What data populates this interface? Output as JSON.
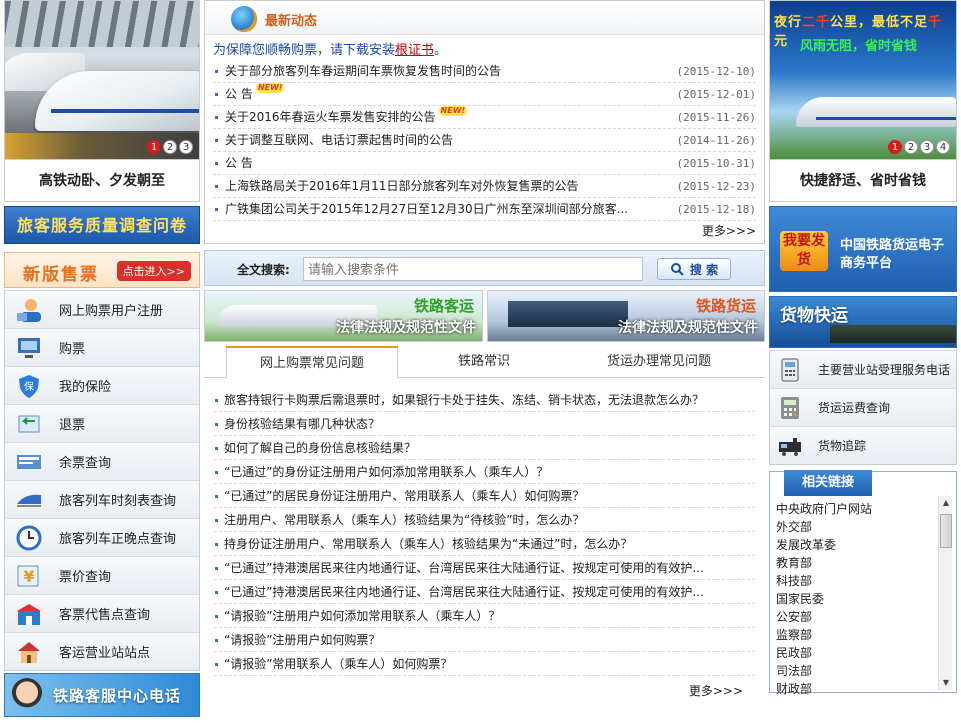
{
  "left": {
    "caption": "高铁动卧、夕发朝至",
    "dots": [
      "1",
      "2",
      "3"
    ],
    "survey": "旅客服务质量调查问卷",
    "newticket": {
      "title": "新版售票",
      "button": "点击进入>>"
    },
    "menu": [
      {
        "label": "网上购票用户注册",
        "icon": "user-register-icon"
      },
      {
        "label": "购票",
        "icon": "ticket-computer-icon"
      },
      {
        "label": "我的保险",
        "icon": "insurance-shield-icon"
      },
      {
        "label": "退票",
        "icon": "refund-arrow-icon"
      },
      {
        "label": "余票查询",
        "icon": "remaining-tickets-icon"
      },
      {
        "label": "旅客列车时刻表查询",
        "icon": "train-schedule-icon"
      },
      {
        "label": "旅客列车正晚点查询",
        "icon": "clock-icon"
      },
      {
        "label": "票价查询",
        "icon": "price-yuan-icon"
      },
      {
        "label": "客票代售点查询",
        "icon": "ticket-agency-icon"
      },
      {
        "label": "客运营业站站点",
        "icon": "station-house-icon"
      }
    ],
    "service": "铁路客服中心电话"
  },
  "news": {
    "title": "最新动态",
    "notice_prefix": "为保障您顺畅购票，请下载安装",
    "notice_link": "根证书",
    "notice_suffix": "。",
    "items": [
      {
        "text": "关于部分旅客列车春运期间车票恢复发售时间的公告",
        "date": "(2015-12-10)",
        "new": false
      },
      {
        "text": "公 告",
        "date": "(2015-12-01)",
        "new": true
      },
      {
        "text": "关于2016年春运火车票发售安排的公告",
        "date": "(2015-11-26)",
        "new": true
      },
      {
        "text": "关于调整互联网、电话订票起售时间的公告",
        "date": "(2014-11-26)",
        "new": false
      },
      {
        "text": "公 告",
        "date": "(2015-10-31)",
        "new": false
      },
      {
        "text": "上海铁路局关于2016年1月11日部分旅客列车对外恢复售票的公告",
        "date": "(2015-12-23)",
        "new": false
      },
      {
        "text": "广铁集团公司关于2015年12月27日至12月30日广州东至深圳间部分旅客...",
        "date": "(2015-12-18)",
        "new": false
      }
    ],
    "new_badge": "NEW!",
    "more": "更多>>>"
  },
  "search": {
    "label": "全文搜索:",
    "placeholder": "请输入搜索条件",
    "button": "搜 索"
  },
  "banners": [
    {
      "title": "铁路客运",
      "subtitle": "法律法规及规范性文件",
      "title_color": "#2fa12a"
    },
    {
      "title": "铁路货运",
      "subtitle": "法律法规及规范性文件",
      "title_color": "#e0561a"
    }
  ],
  "tabs": [
    {
      "label": "网上购票常见问题",
      "active": true
    },
    {
      "label": "铁路常识",
      "active": false
    },
    {
      "label": "货运办理常见问题",
      "active": false
    }
  ],
  "faq": [
    "旅客持银行卡购票后需退票时，如果银行卡处于挂失、冻结、销卡状态，无法退款怎么办？",
    "身份核验结果有哪几种状态？",
    "如何了解自己的身份信息核验结果？",
    "“已通过”的身份证注册用户如何添加常用联系人（乘车人）？",
    "“已通过”的居民身份证注册用户、常用联系人（乘车人）如何购票？",
    "注册用户、常用联系人（乘车人）核验结果为“待核验”时，怎么办？",
    "持身份证注册用户、常用联系人（乘车人）核验结果为“未通过”时，怎么办？",
    "“已通过”持港澳居民来往内地通行证、台湾居民来往大陆通行证、按规定可使用的有效护...",
    "“已通过”持港澳居民来往内地通行证、台湾居民来往大陆通行证、按规定可使用的有效护...",
    "“请报验”注册用户如何添加常用联系人（乘车人）？",
    "“请报验”注册用户如何购票？",
    "“请报验”常用联系人（乘车人）如何购票？"
  ],
  "faq_more": "更多>>>",
  "right": {
    "slogan_pre": "夜行",
    "slogan_red1": "二千",
    "slogan_mid": "公里，最低不足",
    "slogan_red2": "千",
    "slogan_end": "元",
    "slogan_2": "风雨无阻，省时省钱",
    "dots": [
      "1",
      "2",
      "3",
      "4"
    ],
    "caption": "快捷舒适、省时省钱",
    "ecom_box": "我要发货",
    "ecom_text": "中国铁路货运电子商务平台",
    "fastgoods": "货物快运",
    "menu": [
      {
        "label": "主要营业站受理服务电话",
        "icon": "phone-icon"
      },
      {
        "label": "货运运费查询",
        "icon": "calculator-icon"
      },
      {
        "label": "货物追踪",
        "icon": "freight-train-icon"
      }
    ],
    "links_title": "相关链接",
    "links": [
      "中央政府门户网站",
      "外交部",
      "发展改革委",
      "教育部",
      "科技部",
      "国家民委",
      "公安部",
      "监察部",
      "民政部",
      "司法部",
      "财政部"
    ]
  }
}
